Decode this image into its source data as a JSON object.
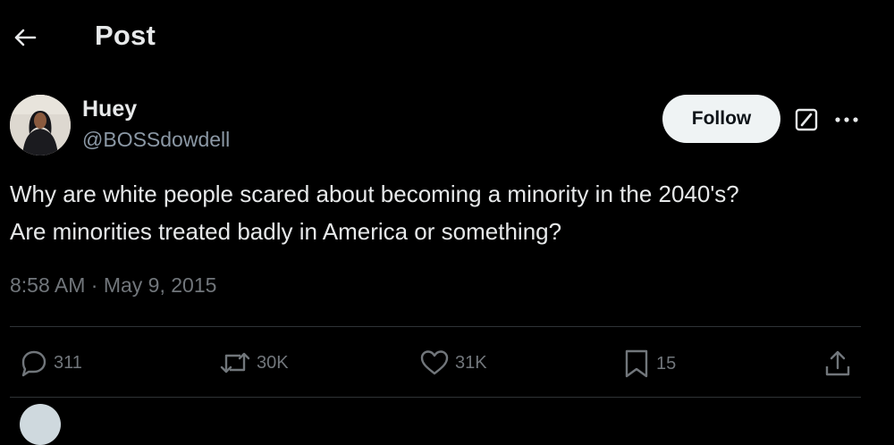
{
  "header": {
    "title": "Post",
    "back_icon": "arrow-left-icon"
  },
  "tweet": {
    "author_name": "Huey",
    "author_handle": "@BOSSdowdell",
    "follow_label": "Follow",
    "text_lines": [
      "Why are white people scared about becoming a minority in the 2040's?",
      "Are minorities treated badly in America or something?"
    ],
    "time": "8:58 AM",
    "separator": "·",
    "date": "May 9, 2015"
  },
  "actions": {
    "replies": "311",
    "reposts": "30K",
    "likes": "31K",
    "bookmarks": "15"
  },
  "icons": [
    "arrow-left-icon",
    "grok-icon",
    "more-icon",
    "reply-icon",
    "repost-icon",
    "like-icon",
    "bookmark-icon",
    "share-icon"
  ],
  "colors": {
    "background": "#000000",
    "text": "#e7e9ea",
    "secondary": "#71767b",
    "divider": "#2f3336",
    "follow_bg": "#eff3f4"
  }
}
